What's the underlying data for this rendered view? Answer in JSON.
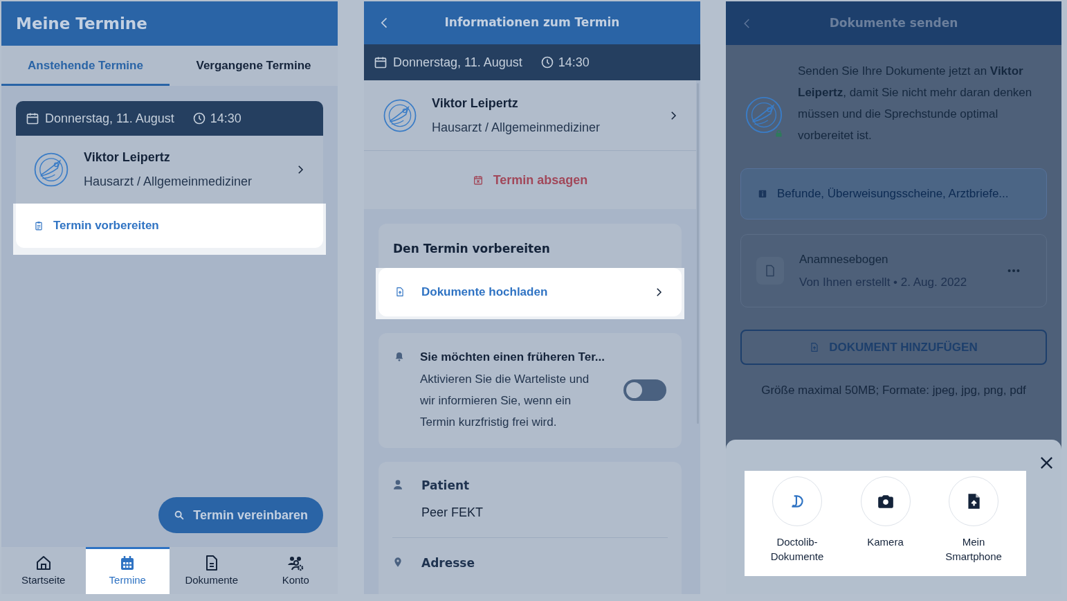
{
  "appointments_screen": {
    "title": "Meine Termine",
    "tabs": [
      {
        "label": "Anstehende Termine",
        "selected": true
      },
      {
        "label": "Vergangene Termine",
        "selected": false
      }
    ],
    "appointment": {
      "date": "Donnerstag, 11. August",
      "time": "14:30",
      "doctor": "Viktor Leipertz",
      "specialty": "Hausarzt / Allgemeinmediziner",
      "action": {
        "label": "Termin vorbereiten",
        "highlighted": true
      }
    },
    "book_button": "Termin vereinbaren",
    "nav": [
      {
        "kind": "home",
        "label": "Startseite",
        "selected": false
      },
      {
        "kind": "calendar",
        "label": "Termine",
        "selected": true
      },
      {
        "kind": "document",
        "label": "Dokumente",
        "selected": false
      },
      {
        "kind": "account",
        "label": "Konto",
        "selected": false
      }
    ]
  },
  "details_screen": {
    "title": "Informationen zum Termin",
    "date": "Donnerstag, 11. August",
    "time": "14:30",
    "doctor": "Viktor Leipertz",
    "specialty": "Hausarzt / Allgemeinmediziner",
    "cancel_label": "Termin absagen",
    "prepare": {
      "title": "Den Termin vorbereiten",
      "items": [
        {
          "label": "Dokumente hochladen",
          "highlighted": true
        }
      ]
    },
    "waitlist": {
      "title": "Sie möchten einen früheren Ter...",
      "text": "Aktivieren Sie die Warteliste und wir informieren Sie, wenn ein Termin kurzfristig frei wird.",
      "on": false
    },
    "info": [
      {
        "kind": "person",
        "label": "Patient",
        "value": "Peer FEKT"
      },
      {
        "kind": "pin",
        "label": "Adresse"
      }
    ]
  },
  "documents_screen": {
    "title": "Dokumente senden",
    "intro": "Senden Sie Ihre Dokumente jetzt an **Viktor Leipertz**, damit Sie nicht mehr daran denken müssen und die Sprechstunde optimal vorbereitet ist.",
    "info_box": "Befunde, Überweisungsscheine, Arztbriefe...",
    "document": {
      "name": "Anamnesebogen",
      "meta": "Von Ihnen erstellt • 2. Aug. 2022"
    },
    "add_button": "DOKUMENT HINZUFÜGEN",
    "hint": "Größe maximal 50MB; Formate: jpeg, jpg, png, pdf",
    "sheet": {
      "options": [
        {
          "kind": "doctolib",
          "label": "Doctolib-Dokumente"
        },
        {
          "kind": "camera",
          "label": "Kamera"
        },
        {
          "kind": "upload",
          "label": "Mein Smartphone"
        }
      ]
    }
  }
}
